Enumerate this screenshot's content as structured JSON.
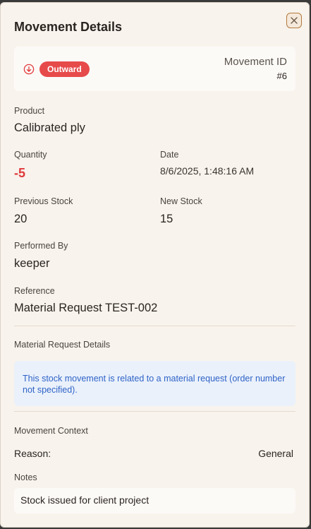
{
  "modal": {
    "title": "Movement Details",
    "close_icon": "close-icon"
  },
  "summary": {
    "direction_icon": "arrow-down-circle-icon",
    "direction_badge": "Outward",
    "badge_color": "#e74a4a",
    "movement_id_label": "Movement ID",
    "movement_id_value": "#6"
  },
  "fields": {
    "product_label": "Product",
    "product_value": "Calibrated ply",
    "quantity_label": "Quantity",
    "quantity_value": "-5",
    "quantity_color": "#e0393b",
    "date_label": "Date",
    "date_value": "8/6/2025, 1:48:16 AM",
    "previous_stock_label": "Previous Stock",
    "previous_stock_value": "20",
    "new_stock_label": "New Stock",
    "new_stock_value": "15",
    "performed_by_label": "Performed By",
    "performed_by_value": "keeper",
    "reference_label": "Reference",
    "reference_value": "Material Request TEST-002"
  },
  "material_request": {
    "section_label": "Material Request Details",
    "info_text": "This stock movement is related to a material request (order number not specified).",
    "info_color": "#2f63c7"
  },
  "context": {
    "section_label": "Movement Context",
    "reason_label": "Reason:",
    "reason_value": "General",
    "notes_label": "Notes",
    "notes_value": "Stock issued for client project"
  }
}
